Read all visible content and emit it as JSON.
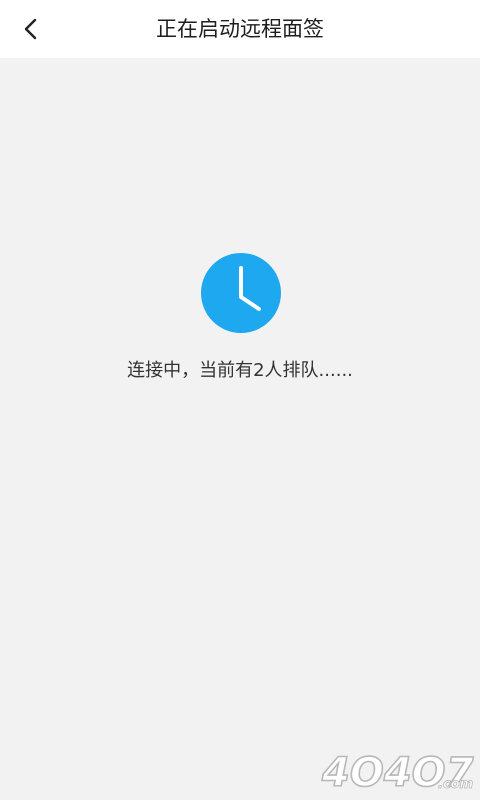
{
  "header": {
    "title": "正在启动远程面签",
    "back_icon": "chevron-left-icon"
  },
  "main": {
    "status_icon": "clock-icon",
    "status_text": "连接中，当前有2人排队......"
  },
  "watermark": {
    "text": "4O4O7.com"
  },
  "colors": {
    "accent": "#1ea8f0",
    "background": "#f2f2f2",
    "header_bg": "#ffffff",
    "text": "#333333"
  }
}
